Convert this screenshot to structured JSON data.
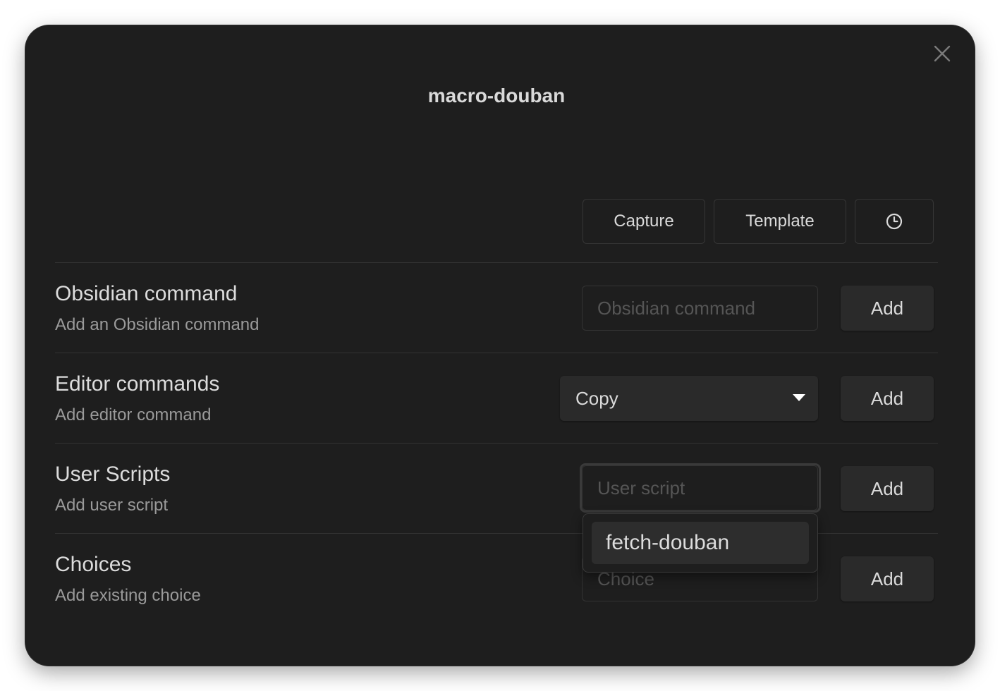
{
  "modal": {
    "title": "macro-douban"
  },
  "toolbar": {
    "capture_label": "Capture",
    "template_label": "Template",
    "clock_icon": "clock-icon"
  },
  "rows": {
    "obsidian": {
      "name": "Obsidian command",
      "desc": "Add an Obsidian command",
      "placeholder": "Obsidian command",
      "add_label": "Add"
    },
    "editor": {
      "name": "Editor commands",
      "desc": "Add editor command",
      "selected": "Copy",
      "add_label": "Add"
    },
    "scripts": {
      "name": "User Scripts",
      "desc": "Add user script",
      "placeholder": "User script",
      "add_label": "Add",
      "suggestions": [
        "fetch-douban"
      ]
    },
    "choices": {
      "name": "Choices",
      "desc": "Add existing choice",
      "placeholder": "Choice",
      "add_label": "Add"
    }
  },
  "colors": {
    "modal_bg": "#1e1e1e",
    "text": "#dadada",
    "muted": "#9a9a9a",
    "button_bg": "#2a2a2a"
  }
}
